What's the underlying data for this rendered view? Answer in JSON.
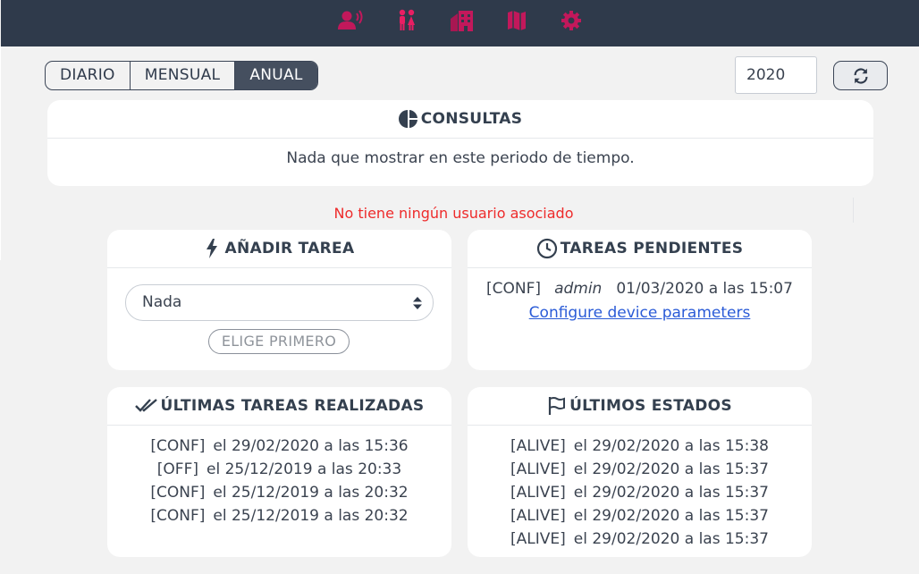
{
  "nav": {
    "items": [
      {
        "icon": "user-voice-icon",
        "color": "#c2185b"
      },
      {
        "icon": "restroom-icon",
        "color": "#e91e63"
      },
      {
        "icon": "building-icon",
        "color": "#c2185b"
      },
      {
        "icon": "map-icon",
        "color": "#c2185b"
      },
      {
        "icon": "gear-icon",
        "color": "#c2185b"
      }
    ]
  },
  "period": {
    "options": [
      "DIARIO",
      "MENSUAL",
      "ANUAL"
    ],
    "selected": "ANUAL"
  },
  "year": {
    "value": "2020"
  },
  "consultas": {
    "title": "CONSULTAS",
    "empty": "Nada que mostrar en este periodo de tiempo."
  },
  "warning": "No tiene ningún usuario asociado",
  "add_task": {
    "title": "AÑADIR TAREA",
    "select_value": "Nada",
    "button": "ELIGE PRIMERO"
  },
  "pending": {
    "title": "TAREAS PENDIENTES",
    "tag": "[CONF]",
    "user": "admin",
    "datetime": "01/03/2020 a las 15:07",
    "link": "Configure device parameters"
  },
  "done": {
    "title": "ÚLTIMAS TAREAS REALIZADAS",
    "items": [
      {
        "tag": "[CONF]",
        "when": "el 29/02/2020 a las 15:36"
      },
      {
        "tag": "[OFF]",
        "when": "el 25/12/2019 a las 20:33"
      },
      {
        "tag": "[CONF]",
        "when": "el 25/12/2019 a las 20:32"
      },
      {
        "tag": "[CONF]",
        "when": "el 25/12/2019 a las 20:32"
      }
    ]
  },
  "states": {
    "title": "ÚLTIMOS ESTADOS",
    "items": [
      {
        "tag": "[ALIVE]",
        "when": "el 29/02/2020 a las 15:38"
      },
      {
        "tag": "[ALIVE]",
        "when": "el 29/02/2020 a las 15:37"
      },
      {
        "tag": "[ALIVE]",
        "when": "el 29/02/2020 a las 15:37"
      },
      {
        "tag": "[ALIVE]",
        "when": "el 29/02/2020 a las 15:37"
      },
      {
        "tag": "[ALIVE]",
        "when": "el 29/02/2020 a las 15:37"
      }
    ]
  }
}
